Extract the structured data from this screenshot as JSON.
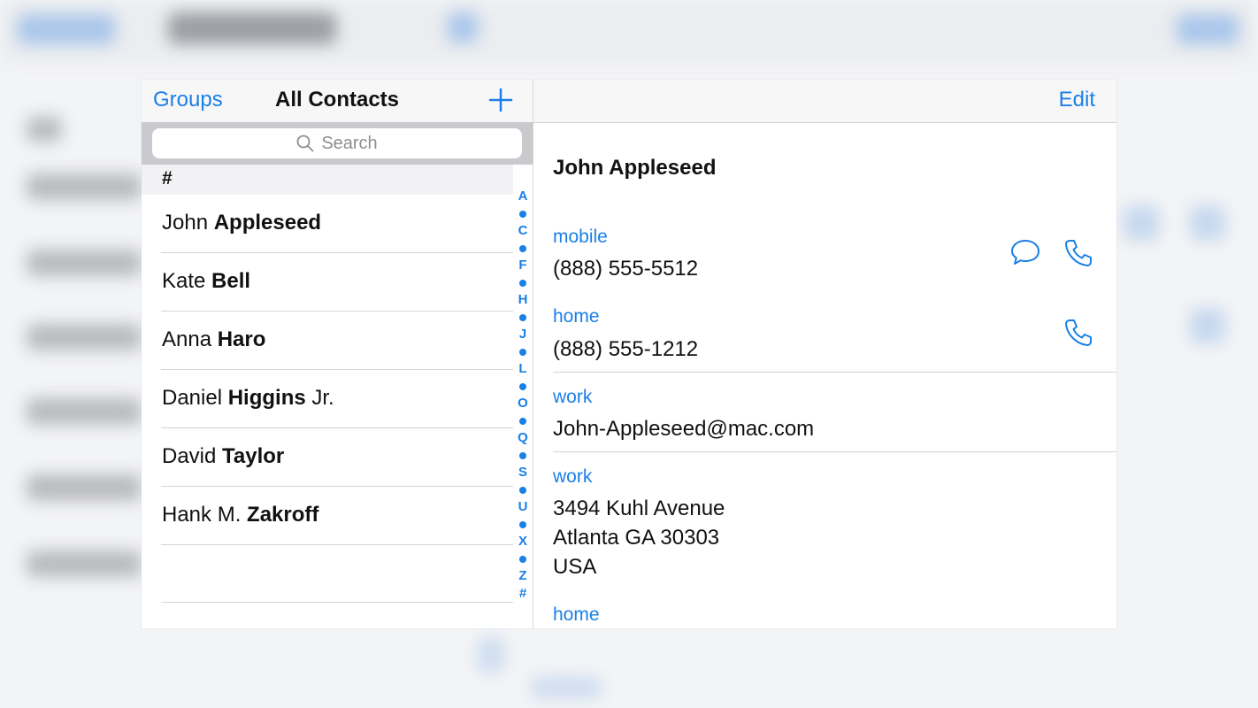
{
  "master": {
    "groups_label": "Groups",
    "title": "All Contacts",
    "add_icon": "plus-icon",
    "search_placeholder": "Search",
    "section_header": "#",
    "contacts": [
      {
        "first": "John ",
        "last": "Appleseed",
        "suffix": ""
      },
      {
        "first": "Kate ",
        "last": "Bell",
        "suffix": ""
      },
      {
        "first": "Anna ",
        "last": "Haro",
        "suffix": ""
      },
      {
        "first": "Daniel ",
        "last": "Higgins",
        "suffix": " Jr."
      },
      {
        "first": "David ",
        "last": "Taylor",
        "suffix": ""
      },
      {
        "first": "Hank M. ",
        "last": "Zakroff",
        "suffix": ""
      }
    ],
    "index_letters": [
      "A",
      "•",
      "C",
      "•",
      "F",
      "•",
      "H",
      "•",
      "J",
      "•",
      "L",
      "•",
      "O",
      "•",
      "Q",
      "•",
      "S",
      "•",
      "U",
      "•",
      "X",
      "•",
      "Z",
      "#"
    ]
  },
  "detail": {
    "edit_label": "Edit",
    "name": "John Appleseed",
    "fields": {
      "mobile_label": "mobile",
      "mobile_value": "(888) 555-5512",
      "home_label": "home",
      "home_value": "(888) 555-1212",
      "email_label": "work",
      "email_value": "John-Appleseed@mac.com",
      "address_label": "work",
      "address_line1": "3494 Kuhl Avenue",
      "address_line2": "Atlanta GA 30303",
      "address_line3": "USA",
      "next_label": "home"
    },
    "icons": [
      "message-icon",
      "phone-icon"
    ]
  },
  "colors": {
    "accent": "#1a7fe6",
    "text": "#111111",
    "separator": "#d4d4d8",
    "search_bg": "#c9c9ce"
  }
}
